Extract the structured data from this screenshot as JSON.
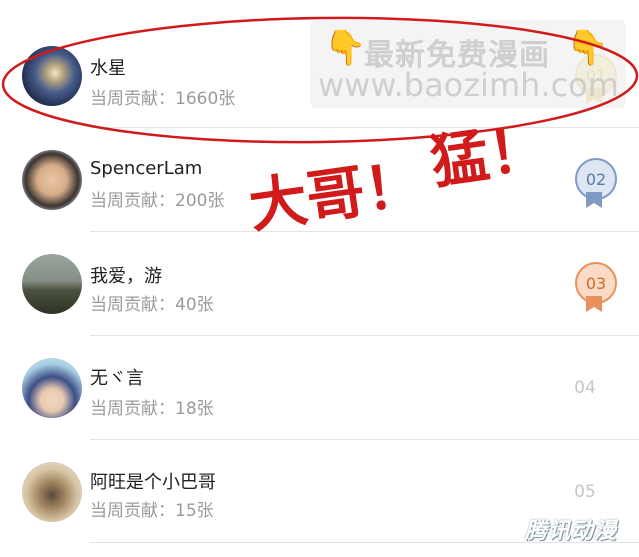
{
  "ranking": [
    {
      "name": "水星",
      "contribution": "当周贡献：1660张",
      "rank": "01"
    },
    {
      "name": "SpencerLam",
      "contribution": "当周贡献：200张",
      "rank": "02"
    },
    {
      "name": "我爱，游",
      "contribution": "当周贡献：40张",
      "rank": "03"
    },
    {
      "name": "无ヾ言",
      "contribution": "当周贡献：18张",
      "rank": "04"
    },
    {
      "name": "阿旺是个小巴哥",
      "contribution": "当周贡献：15张",
      "rank": "05"
    }
  ],
  "annotation": {
    "text1": "大哥！",
    "text2": "猛！"
  },
  "watermark": {
    "line1": "最新免费漫画",
    "line2": "www.baozimh.com"
  },
  "brand": "腾讯动漫",
  "colors": {
    "gold": "#e6c46a",
    "silver": "#7f9bc4",
    "bronze": "#e8915d",
    "annotation": "#d11b1b"
  }
}
